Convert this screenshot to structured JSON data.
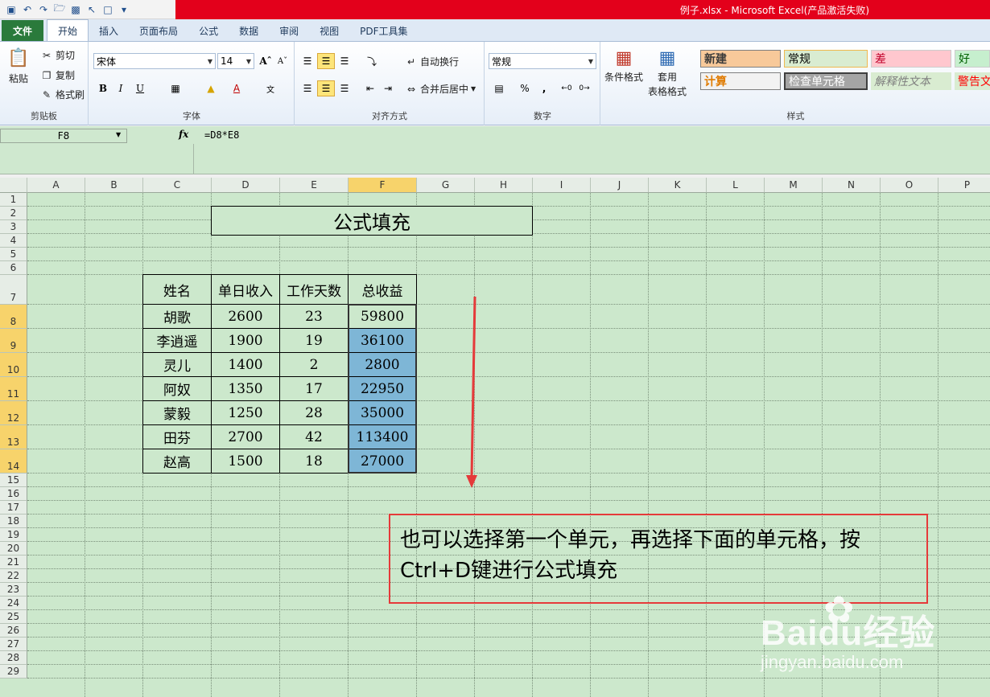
{
  "window": {
    "title": "例子.xlsx - Microsoft Excel(产品激活失败)"
  },
  "tabs": [
    "文件",
    "开始",
    "插入",
    "页面布局",
    "公式",
    "数据",
    "审阅",
    "视图",
    "PDF工具集"
  ],
  "ribbon": {
    "clipboard": {
      "label": "剪贴板",
      "paste": "粘贴",
      "cut": "剪切",
      "copy": "复制",
      "format_painter": "格式刷"
    },
    "font": {
      "label": "字体",
      "font_name": "宋体",
      "font_size": "14",
      "bold": "B",
      "italic": "I",
      "underline": "U"
    },
    "alignment": {
      "label": "对齐方式",
      "wrap": "自动换行",
      "merge": "合并后居中"
    },
    "number": {
      "label": "数字",
      "format": "常规",
      "percent": "%",
      "comma": ","
    },
    "styles": {
      "label": "样式",
      "conditional": "条件格式",
      "table": "套用",
      "table2": "表格格式",
      "cells": [
        "新建",
        "常规",
        "差",
        "好",
        "计算",
        "检查单元格",
        "解释性文本",
        "警告文"
      ]
    }
  },
  "formula_bar": {
    "name_box": "F8",
    "fx": "fx",
    "formula": "=D8*E8"
  },
  "grid": {
    "columns": [
      "A",
      "B",
      "C",
      "D",
      "E",
      "F",
      "G",
      "H",
      "I",
      "J",
      "K",
      "L",
      "M",
      "N",
      "O",
      "P"
    ],
    "rows": [
      "1",
      "2",
      "3",
      "4",
      "5",
      "6",
      "7",
      "8",
      "9",
      "10",
      "11",
      "12",
      "13",
      "14",
      "15",
      "16",
      "17",
      "18",
      "19",
      "20",
      "21",
      "22",
      "23",
      "24",
      "25",
      "26",
      "27",
      "28",
      "29"
    ],
    "title": "公式填充",
    "table_headers": [
      "姓名",
      "单日收入",
      "工作天数",
      "总收益"
    ],
    "table_rows": [
      [
        "胡歌",
        "2600",
        "23",
        "59800"
      ],
      [
        "李逍遥",
        "1900",
        "19",
        "36100"
      ],
      [
        "灵儿",
        "1400",
        "2",
        "2800"
      ],
      [
        "阿奴",
        "1350",
        "17",
        "22950"
      ],
      [
        "蒙毅",
        "1250",
        "28",
        "35000"
      ],
      [
        "田芬",
        "2700",
        "42",
        "113400"
      ],
      [
        "赵高",
        "1500",
        "18",
        "27000"
      ]
    ]
  },
  "annotation": {
    "text": "也可以选择第一个单元，再选择下面的单元格，按Ctrl+D键进行公式填充"
  },
  "watermark": {
    "brand": "Baidu经验",
    "url": "jingyan.baidu.com"
  },
  "colors": {
    "title_red": "#e3001b",
    "grid_green": "#cce8cc",
    "selected_blue": "#7eb6d6",
    "selected_header": "#f7d36b",
    "annotation_red": "#e53a3a"
  }
}
